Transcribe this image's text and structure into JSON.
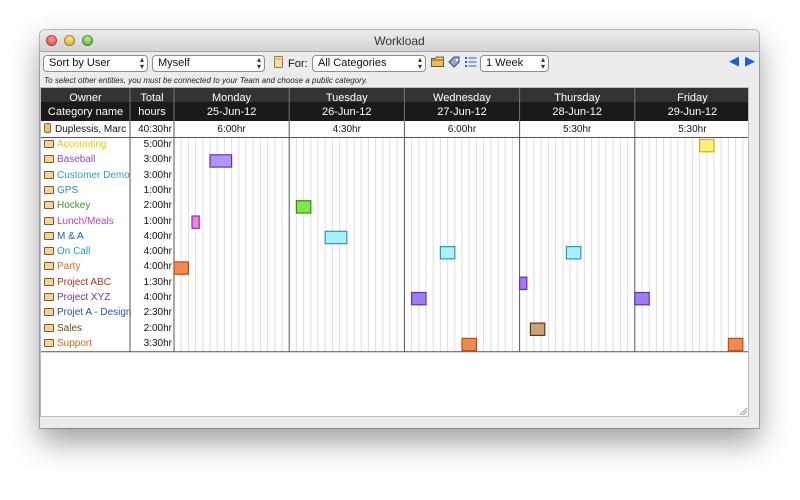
{
  "window": {
    "title": "Workload"
  },
  "toolbar": {
    "sort_value": "Sort by User",
    "user_value": "Myself",
    "for_label": "For:",
    "category_value": "All Categories",
    "range_value": "1 Week",
    "hint": "To select other entities, you must be connected to your Team and choose a public category."
  },
  "icons": [
    "folder-icon",
    "tag-icon",
    "list-icon",
    "arrow-left-icon",
    "arrow-right-icon",
    "document-icon"
  ],
  "header": {
    "owner": "Owner",
    "category": "Category name",
    "total1": "Total",
    "total2": "hours"
  },
  "days": [
    {
      "name": "Monday",
      "date": "25-Jun-12",
      "owner_hours": "6:00hr"
    },
    {
      "name": "Tuesday",
      "date": "26-Jun-12",
      "owner_hours": "4:30hr"
    },
    {
      "name": "Wednesday",
      "date": "27-Jun-12",
      "owner_hours": "6:00hr"
    },
    {
      "name": "Thursday",
      "date": "28-Jun-12",
      "owner_hours": "5:30hr"
    },
    {
      "name": "Friday",
      "date": "29-Jun-12",
      "owner_hours": "5:30hr"
    }
  ],
  "owner": {
    "name": "Duplessis, Marc",
    "total": "40:30hr"
  },
  "categories": [
    {
      "name": "Accounting",
      "total": "5:00hr",
      "color": "#f2c21d"
    },
    {
      "name": "Baseball",
      "total": "3:00hr",
      "color": "#8f47d6"
    },
    {
      "name": "Customer Demo",
      "total": "3:00hr",
      "color": "#2c9fbd"
    },
    {
      "name": "GPS",
      "total": "1:00hr",
      "color": "#2a8fc7"
    },
    {
      "name": "Hockey",
      "total": "2:00hr",
      "color": "#3f9a26"
    },
    {
      "name": "Lunch/Meals",
      "total": "1:00hr",
      "color": "#c43cc0"
    },
    {
      "name": "M & A",
      "total": "4:00hr",
      "color": "#2660b8"
    },
    {
      "name": "On Call",
      "total": "4:00hr",
      "color": "#1e9ec0"
    },
    {
      "name": "Party",
      "total": "4:00hr",
      "color": "#e06a1f"
    },
    {
      "name": "Project ABC",
      "total": "1:30hr",
      "color": "#b0341f"
    },
    {
      "name": "Project XYZ",
      "total": "4:00hr",
      "color": "#6a34b8"
    },
    {
      "name": "Projet A - Design",
      "total": "2:30hr",
      "color": "#2a4fb0"
    },
    {
      "name": "Sales",
      "total": "2:00hr",
      "color": "#6e4a1f"
    },
    {
      "name": "Support",
      "total": "3:30hr",
      "color": "#d8641a"
    }
  ],
  "schedule": {
    "slots_per_day": 16,
    "blocks": [
      {
        "row": 0,
        "day": 4,
        "start": 9,
        "end": 11,
        "fill": "#fff27a",
        "stroke": "#c8b400"
      },
      {
        "row": 1,
        "day": 0,
        "start": 5,
        "end": 8,
        "fill": "#b294ff",
        "stroke": "#5a35b8"
      },
      {
        "row": 4,
        "day": 1,
        "start": 1,
        "end": 3,
        "fill": "#7ee84a",
        "stroke": "#3a8a1a"
      },
      {
        "row": 5,
        "day": 0,
        "start": 2.5,
        "end": 3.5,
        "fill": "#ec82f0",
        "stroke": "#9a2a9a"
      },
      {
        "row": 6,
        "day": 1,
        "start": 5,
        "end": 8,
        "fill": "#a8f2f6",
        "stroke": "#2a9ab8"
      },
      {
        "row": 7,
        "day": 2,
        "start": 5,
        "end": 7,
        "fill": "#a8f2f6",
        "stroke": "#2a9ab8"
      },
      {
        "row": 7,
        "day": 3,
        "start": 6.5,
        "end": 8.5,
        "fill": "#a8f2f6",
        "stroke": "#2a9ab8"
      },
      {
        "row": 8,
        "day": 0,
        "start": 0,
        "end": 2,
        "fill": "#f08a4e",
        "stroke": "#c04a12"
      },
      {
        "row": 9,
        "day": 3,
        "start": 0,
        "end": 1,
        "fill": "#a27af2",
        "stroke": "#5a35b8"
      },
      {
        "row": 10,
        "day": 2,
        "start": 1,
        "end": 3,
        "fill": "#a27af2",
        "stroke": "#5a35b8"
      },
      {
        "row": 10,
        "day": 4,
        "start": 0,
        "end": 2,
        "fill": "#a27af2",
        "stroke": "#5a35b8"
      },
      {
        "row": 12,
        "day": 3,
        "start": 1.5,
        "end": 3.5,
        "fill": "#c9a27a",
        "stroke": "#5e3a14"
      },
      {
        "row": 13,
        "day": 2,
        "start": 8,
        "end": 10,
        "fill": "#f08a4e",
        "stroke": "#c04a12"
      },
      {
        "row": 13,
        "day": 4,
        "start": 13,
        "end": 15,
        "fill": "#f08a4e",
        "stroke": "#c04a12"
      }
    ]
  }
}
